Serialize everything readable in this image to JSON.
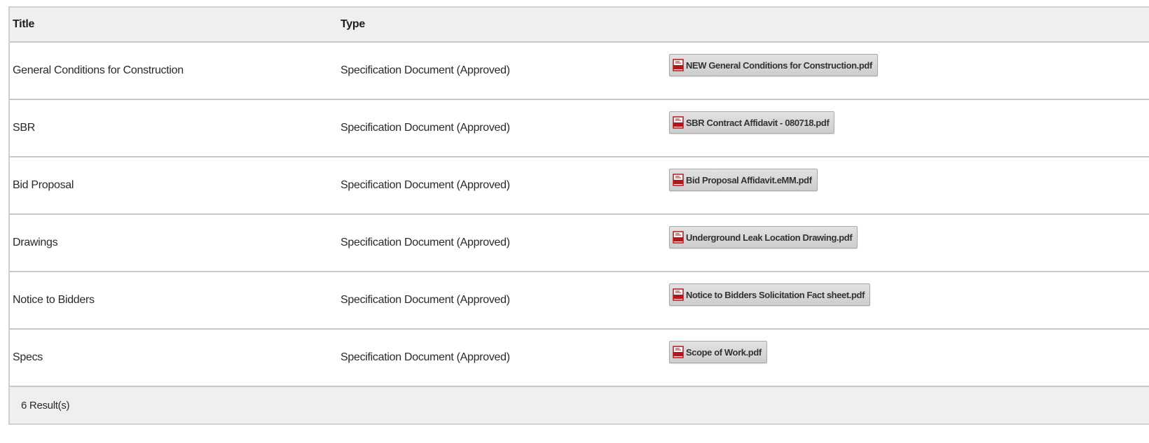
{
  "table": {
    "headers": {
      "title": "Title",
      "type": "Type"
    },
    "rows": [
      {
        "title": "General Conditions for Construction",
        "type": "Specification Document (Approved)",
        "file": "NEW General Conditions for Construction.pdf"
      },
      {
        "title": "SBR",
        "type": "Specification Document (Approved)",
        "file": "SBR Contract Affidavit - 080718.pdf"
      },
      {
        "title": "Bid Proposal",
        "type": "Specification Document (Approved)",
        "file": "Bid Proposal Affidavit.eMM.pdf"
      },
      {
        "title": "Drawings",
        "type": "Specification Document (Approved)",
        "file": "Underground Leak Location Drawing.pdf"
      },
      {
        "title": "Notice to Bidders",
        "type": "Specification Document (Approved)",
        "file": "Notice to Bidders Solicitation Fact sheet.pdf"
      },
      {
        "title": "Specs",
        "type": "Specification Document (Approved)",
        "file": "Scope of Work.pdf"
      }
    ],
    "footer": {
      "results": "6 Result(s)"
    }
  },
  "icons": {
    "file_icon": "pdf-icon"
  },
  "colors": {
    "pdf_icon_red": "#b3161b",
    "header_bg": "#efefef",
    "border": "#c8c8c8"
  }
}
